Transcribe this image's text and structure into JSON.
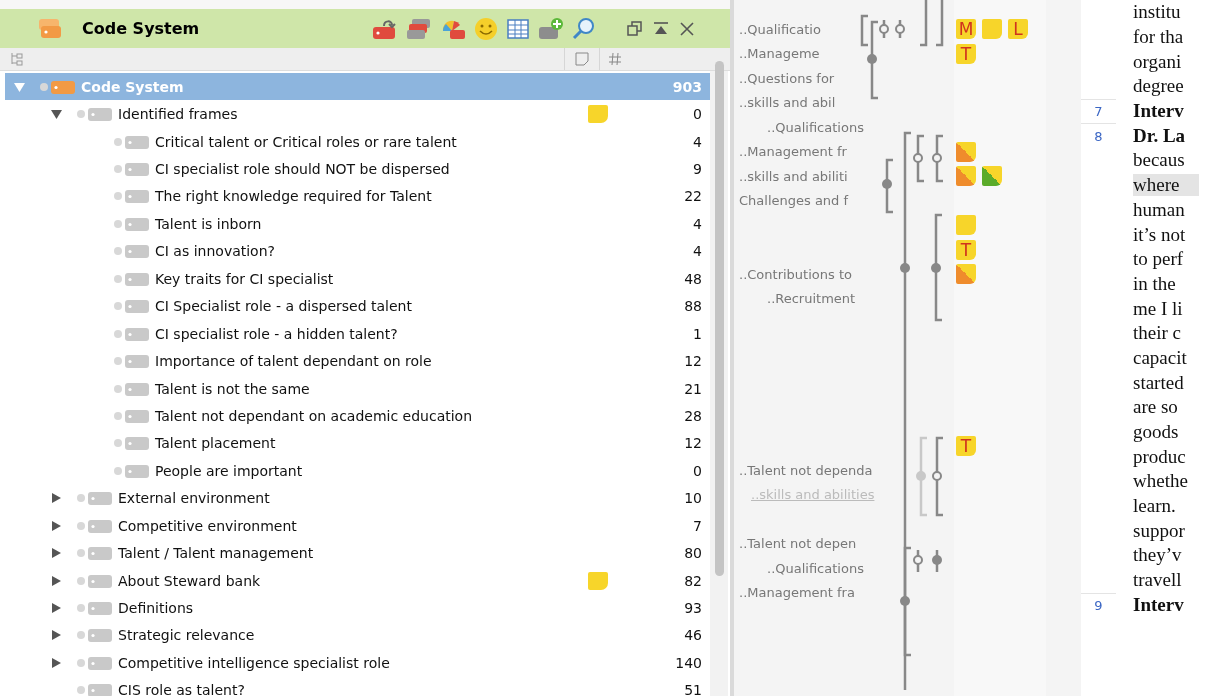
{
  "panel": {
    "title": "Code System"
  },
  "tree": [
    {
      "label": "Code System",
      "count": "903",
      "kind": "root",
      "selected": true,
      "expanded": true,
      "memo": false,
      "children": [
        {
          "label": "Identified frames",
          "count": "0",
          "kind": "code",
          "selected": false,
          "expanded": true,
          "memo": true,
          "children": [
            {
              "label": "Critical talent or Critical roles or rare talent",
              "count": "4",
              "kind": "code",
              "selected": false,
              "memo": false
            },
            {
              "label": "CI specialist role should NOT be dispersed",
              "count": "9",
              "kind": "code",
              "selected": false,
              "memo": false
            },
            {
              "label": "The right knowledge required for Talent",
              "count": "22",
              "kind": "code",
              "selected": false,
              "memo": false
            },
            {
              "label": "Talent is inborn",
              "count": "4",
              "kind": "code",
              "selected": false,
              "memo": false
            },
            {
              "label": "CI as innovation?",
              "count": "4",
              "kind": "code",
              "selected": false,
              "memo": false
            },
            {
              "label": "Key traits for CI specialist",
              "count": "48",
              "kind": "code",
              "selected": false,
              "memo": false
            },
            {
              "label": "CI Specialist role - a dispersed talent",
              "count": "88",
              "kind": "code",
              "selected": false,
              "memo": false
            },
            {
              "label": "CI specialist role - a hidden talent?",
              "count": "1",
              "kind": "code",
              "selected": false,
              "memo": false
            },
            {
              "label": "Importance of talent dependant on role",
              "count": "12",
              "kind": "code",
              "selected": false,
              "memo": false
            },
            {
              "label": "Talent is not the same",
              "count": "21",
              "kind": "code",
              "selected": false,
              "memo": false
            },
            {
              "label": "Talent not dependant on academic education",
              "count": "28",
              "kind": "code",
              "selected": false,
              "memo": false
            },
            {
              "label": "Talent placement",
              "count": "12",
              "kind": "code",
              "selected": false,
              "memo": false
            },
            {
              "label": "People are important",
              "count": "0",
              "kind": "code",
              "selected": false,
              "memo": false
            }
          ]
        },
        {
          "label": "External environment",
          "count": "10",
          "kind": "code",
          "selected": false,
          "expanded": false,
          "memo": false
        },
        {
          "label": "Competitive environment",
          "count": "7",
          "kind": "code",
          "selected": false,
          "expanded": false,
          "memo": false
        },
        {
          "label": "Talent / Talent management",
          "count": "80",
          "kind": "code",
          "selected": false,
          "expanded": false,
          "memo": false
        },
        {
          "label": "About Steward bank",
          "count": "82",
          "kind": "code",
          "selected": false,
          "expanded": false,
          "memo": true
        },
        {
          "label": "Definitions",
          "count": "93",
          "kind": "code",
          "selected": false,
          "expanded": false,
          "memo": false
        },
        {
          "label": "Strategic relevance",
          "count": "46",
          "kind": "code",
          "selected": false,
          "expanded": false,
          "memo": false
        },
        {
          "label": "Competitive intelligence specialist role",
          "count": "140",
          "kind": "code",
          "selected": false,
          "expanded": false,
          "memo": false
        },
        {
          "label": "CIS role as talent?",
          "count": "51",
          "kind": "code",
          "selected": false,
          "memo": false
        }
      ]
    }
  ],
  "margin": [
    {
      "kind": "code",
      "label": "..Qualificatio",
      "memos": [
        {
          "kind": "letter",
          "label": "M"
        },
        {
          "kind": "plain"
        },
        {
          "kind": "letter",
          "label": "L"
        }
      ]
    },
    {
      "kind": "code",
      "label": "..Manageme",
      "memos": [
        {
          "kind": "letter",
          "label": "T"
        }
      ]
    },
    {
      "kind": "code",
      "label": "..Questions for"
    },
    {
      "kind": "code",
      "label": "..skills and abil"
    },
    {
      "kind": "sub",
      "label": "..Qualifications"
    },
    {
      "kind": "code",
      "label": "..Management fr",
      "memos": [
        {
          "kind": "split",
          "color": "#ef8c2c"
        }
      ]
    },
    {
      "kind": "code",
      "label": "..skills and abiliti",
      "memos": [
        {
          "kind": "split",
          "color": "#ef8c2c"
        },
        {
          "kind": "split",
          "color": "#5aab2a"
        }
      ]
    },
    {
      "kind": "code",
      "label": "Challenges and f"
    },
    {
      "kind": "empty",
      "memos": [
        {
          "kind": "plain"
        }
      ]
    },
    {
      "kind": "empty",
      "memos": [
        {
          "kind": "letter",
          "label": "T"
        }
      ]
    },
    {
      "kind": "code",
      "label": "..Contributions to",
      "memos": [
        {
          "kind": "split",
          "color": "#ef8c2c"
        }
      ]
    },
    {
      "kind": "sub",
      "label": "..Recruitment"
    },
    {
      "kind": "empty"
    },
    {
      "kind": "empty"
    },
    {
      "kind": "empty"
    },
    {
      "kind": "empty"
    },
    {
      "kind": "empty"
    },
    {
      "kind": "empty",
      "memos": [
        {
          "kind": "letter",
          "label": "T"
        }
      ]
    },
    {
      "kind": "code",
      "label": "..Talent not dependa"
    },
    {
      "kind": "link",
      "label": "..skills and abilities"
    },
    {
      "kind": "empty"
    },
    {
      "kind": "code",
      "label": "..Talent not depen"
    },
    {
      "kind": "sub",
      "label": "..Qualifications"
    },
    {
      "kind": "code",
      "label": "..Management fra"
    }
  ],
  "document": [
    {
      "text": "institu",
      "bold": false,
      "highlighted": false
    },
    {
      "text": "for tha",
      "bold": false,
      "highlighted": false
    },
    {
      "text": "organi",
      "bold": false,
      "highlighted": false
    },
    {
      "text": "degree",
      "bold": false,
      "highlighted": false
    },
    {
      "number": "7",
      "text": "Interv",
      "bold": true,
      "highlighted": false
    },
    {
      "number": "8",
      "text": "Dr. La",
      "bold": true,
      "highlighted": false
    },
    {
      "text": "becaus",
      "bold": false,
      "highlighted": false
    },
    {
      "text": "where",
      "bold": false,
      "highlighted": true
    },
    {
      "text": "human",
      "bold": false,
      "highlighted": false
    },
    {
      "text": "it’s not",
      "bold": false,
      "highlighted": false
    },
    {
      "text": "to perf",
      "bold": false,
      "highlighted": false
    },
    {
      "text": "in the",
      "bold": false,
      "highlighted": false
    },
    {
      "text": "me I li",
      "bold": false,
      "highlighted": false
    },
    {
      "text": "their c",
      "bold": false,
      "highlighted": false
    },
    {
      "text": "capacit",
      "bold": false,
      "highlighted": false
    },
    {
      "text": "started",
      "bold": false,
      "highlighted": false
    },
    {
      "text": "are so",
      "bold": false,
      "highlighted": false
    },
    {
      "text": "goods",
      "bold": false,
      "highlighted": false
    },
    {
      "text": "produc",
      "bold": false,
      "highlighted": false
    },
    {
      "text": "whethe",
      "bold": false,
      "highlighted": false
    },
    {
      "text": "learn.",
      "bold": false,
      "highlighted": false
    },
    {
      "text": "suppor",
      "bold": false,
      "highlighted": false
    },
    {
      "text": "they’v",
      "bold": false,
      "highlighted": false
    },
    {
      "text": "travell",
      "bold": false,
      "highlighted": false
    },
    {
      "number": "9",
      "text": "Interv",
      "bold": true,
      "highlighted": false
    }
  ]
}
